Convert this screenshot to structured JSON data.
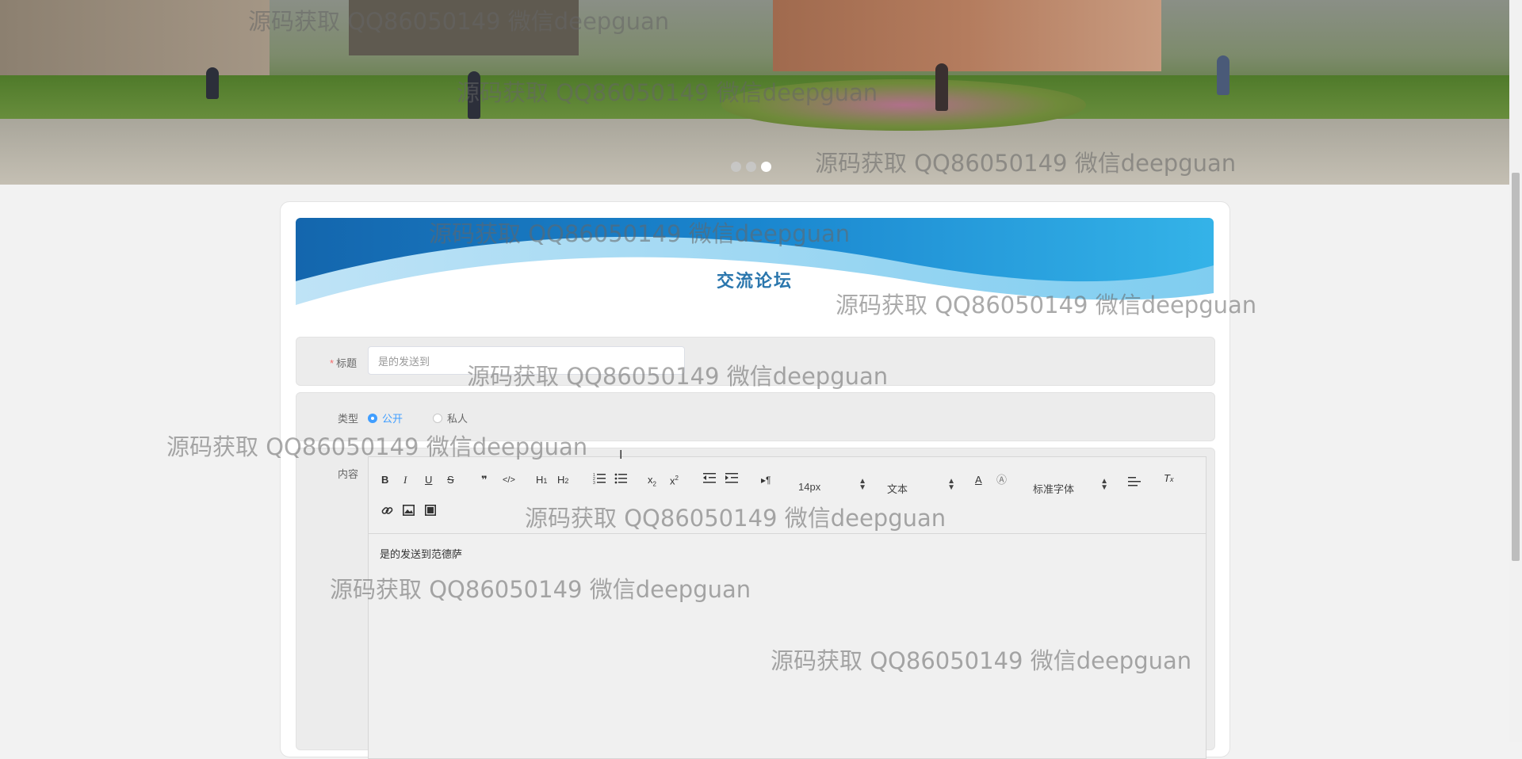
{
  "banner": {
    "slides": 3,
    "active_slide": 3
  },
  "page": {
    "title": "交流论坛"
  },
  "form": {
    "title_label": "标题",
    "title_value": "是的发送到",
    "type_label": "类型",
    "type_options": [
      "公开",
      "私人"
    ],
    "type_selected": "公开",
    "content_label": "内容"
  },
  "editor": {
    "toolbar": {
      "font_size": "14px",
      "heading": "文本",
      "font_family": "标准字体"
    },
    "tools": [
      "bold-icon",
      "italic-icon",
      "underline-icon",
      "strikethrough-icon",
      "blockquote-icon",
      "code-block-icon",
      "h1-icon",
      "h2-icon",
      "ordered-list-icon",
      "bullet-list-icon",
      "subscript-icon",
      "superscript-icon",
      "outdent-icon",
      "indent-icon",
      "rtl-icon",
      "font-color-icon",
      "background-color-icon",
      "align-icon",
      "clear-format-icon",
      "link-icon",
      "image-icon",
      "video-icon"
    ],
    "content": "是的发送到范德萨"
  },
  "watermark": "源码获取 QQ86050149 微信deepguan",
  "colors": {
    "accent": "#409eff",
    "title_blue": "#2a76ad"
  }
}
